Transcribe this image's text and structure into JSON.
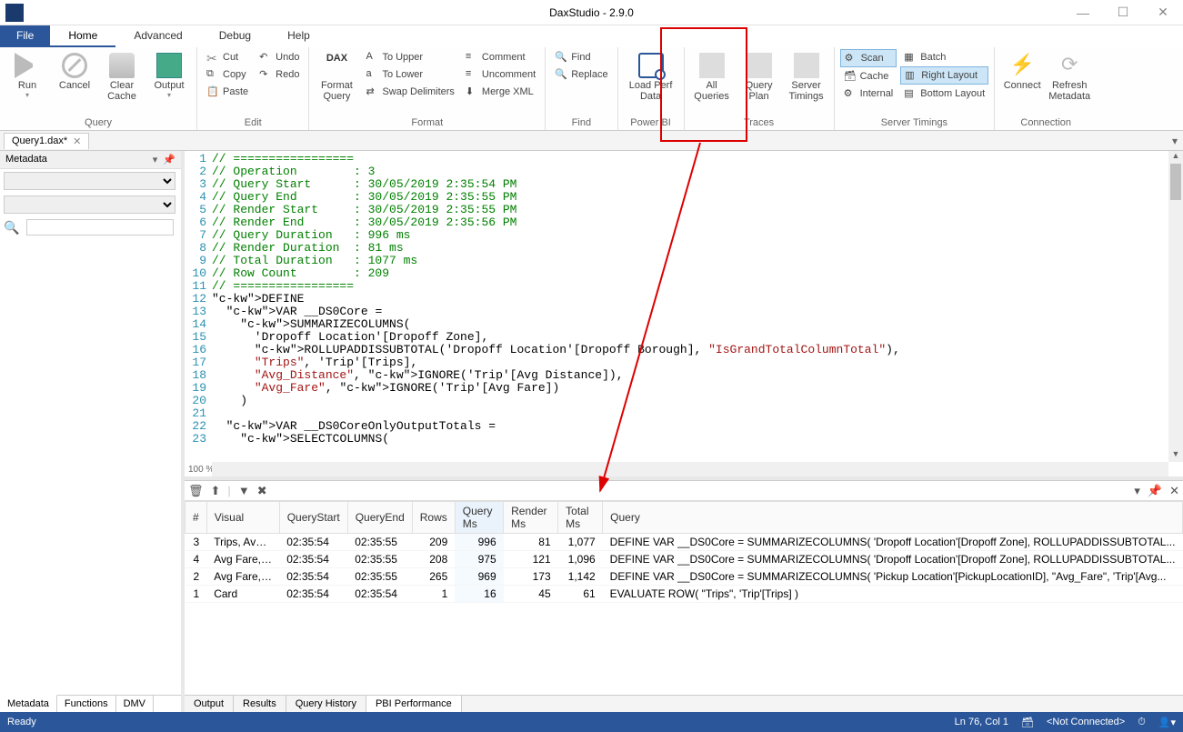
{
  "window": {
    "title": "DaxStudio - 2.9.0"
  },
  "menu": {
    "file": "File",
    "home": "Home",
    "advanced": "Advanced",
    "debug": "Debug",
    "help": "Help"
  },
  "ribbon": {
    "query": {
      "label": "Query",
      "run": "Run",
      "cancel": "Cancel",
      "clear": "Clear Cache",
      "output": "Output"
    },
    "edit": {
      "label": "Edit",
      "cut": "Cut",
      "copy": "Copy",
      "paste": "Paste",
      "undo": "Undo",
      "redo": "Redo"
    },
    "format": {
      "label": "Format",
      "fmtq": "Format Query",
      "upper": "To Upper",
      "lower": "To Lower",
      "swap": "Swap Delimiters",
      "comment": "Comment",
      "uncomment": "Uncomment",
      "merge": "Merge XML"
    },
    "find": {
      "label": "Find",
      "find": "Find",
      "replace": "Replace"
    },
    "powerbi": {
      "label": "Power BI",
      "load": "Load Perf Data"
    },
    "traces": {
      "label": "Traces",
      "all": "All Queries",
      "plan": "Query Plan",
      "timings": "Server Timings"
    },
    "st": {
      "label": "Server Timings",
      "scan": "Scan",
      "cache": "Cache",
      "internal": "Internal",
      "batch": "Batch",
      "right": "Right Layout",
      "bottom": "Bottom Layout"
    },
    "conn": {
      "label": "Connection",
      "connect": "Connect",
      "refresh": "Refresh Metadata"
    }
  },
  "doctab": "Query1.dax*",
  "sidebar": {
    "title": "Metadata",
    "tabs": {
      "meta": "Metadata",
      "func": "Functions",
      "dmv": "DMV"
    }
  },
  "code_lines": [
    "// =================",
    "// Operation        : 3",
    "// Query Start      : 30/05/2019 2:35:54 PM",
    "// Query End        : 30/05/2019 2:35:55 PM",
    "// Render Start     : 30/05/2019 2:35:55 PM",
    "// Render End       : 30/05/2019 2:35:56 PM",
    "// Query Duration   : 996 ms",
    "// Render Duration  : 81 ms",
    "// Total Duration   : 1077 ms",
    "// Row Count        : 209",
    "// =================",
    "DEFINE",
    "  VAR __DS0Core =",
    "    SUMMARIZECOLUMNS(",
    "      'Dropoff Location'[Dropoff Zone],",
    "      ROLLUPADDISSUBTOTAL('Dropoff Location'[Dropoff Borough], \"IsGrandTotalColumnTotal\"),",
    "      \"Trips\", 'Trip'[Trips],",
    "      \"Avg_Distance\", IGNORE('Trip'[Avg Distance]),",
    "      \"Avg_Fare\", IGNORE('Trip'[Avg Fare])",
    "    )",
    "",
    "  VAR __DS0CoreOnlyOutputTotals =",
    "    SELECTCOLUMNS("
  ],
  "zoom": "100 %",
  "grid": {
    "headers": {
      "n": "#",
      "visual": "Visual",
      "qs": "QueryStart",
      "qe": "QueryEnd",
      "rows": "Rows",
      "qms": "Query Ms",
      "rms": "Render Ms",
      "tms": "Total Ms",
      "query": "Query"
    },
    "rows": [
      {
        "n": "3",
        "visual": "Trips, Avg D",
        "qs": "02:35:54",
        "qe": "02:35:55",
        "rows": "209",
        "qms": "996",
        "rms": "81",
        "tms": "1,077",
        "query": "DEFINE VAR __DS0Core = SUMMARIZECOLUMNS( 'Dropoff Location'[Dropoff Zone], ROLLUPADDISSUBTOTAL..."
      },
      {
        "n": "4",
        "visual": "Avg Fare, Tr",
        "qs": "02:35:54",
        "qe": "02:35:55",
        "rows": "208",
        "qms": "975",
        "rms": "121",
        "tms": "1,096",
        "query": "DEFINE VAR __DS0Core = SUMMARIZECOLUMNS( 'Dropoff Location'[Dropoff Zone], ROLLUPADDISSUBTOTAL..."
      },
      {
        "n": "2",
        "visual": "Avg Fare, Fi",
        "qs": "02:35:54",
        "qe": "02:35:55",
        "rows": "265",
        "qms": "969",
        "rms": "173",
        "tms": "1,142",
        "query": "DEFINE VAR __DS0Core = SUMMARIZECOLUMNS( 'Pickup Location'[PickupLocationID], \"Avg_Fare\", 'Trip'[Avg..."
      },
      {
        "n": "1",
        "visual": "Card",
        "qs": "02:35:54",
        "qe": "02:35:54",
        "rows": "1",
        "qms": "16",
        "rms": "45",
        "tms": "61",
        "query": "EVALUATE ROW( \"Trips\", 'Trip'[Trips] )"
      }
    ]
  },
  "results_tabs": {
    "output": "Output",
    "results": "Results",
    "history": "Query History",
    "pbi": "PBI Performance"
  },
  "status": {
    "ready": "Ready",
    "pos": "Ln 76, Col 1",
    "conn": "<Not Connected>"
  }
}
